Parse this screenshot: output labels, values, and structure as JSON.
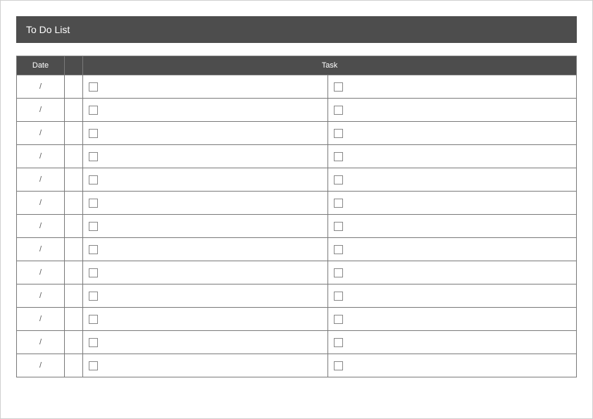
{
  "title": "To Do List",
  "headers": {
    "date": "Date",
    "spacer": "",
    "task": "Task"
  },
  "rows": [
    {
      "date": "/",
      "task1": "",
      "task2": ""
    },
    {
      "date": "/",
      "task1": "",
      "task2": ""
    },
    {
      "date": "/",
      "task1": "",
      "task2": ""
    },
    {
      "date": "/",
      "task1": "",
      "task2": ""
    },
    {
      "date": "/",
      "task1": "",
      "task2": ""
    },
    {
      "date": "/",
      "task1": "",
      "task2": ""
    },
    {
      "date": "/",
      "task1": "",
      "task2": ""
    },
    {
      "date": "/",
      "task1": "",
      "task2": ""
    },
    {
      "date": "/",
      "task1": "",
      "task2": ""
    },
    {
      "date": "/",
      "task1": "",
      "task2": ""
    },
    {
      "date": "/",
      "task1": "",
      "task2": ""
    },
    {
      "date": "/",
      "task1": "",
      "task2": ""
    },
    {
      "date": "/",
      "task1": "",
      "task2": ""
    }
  ]
}
